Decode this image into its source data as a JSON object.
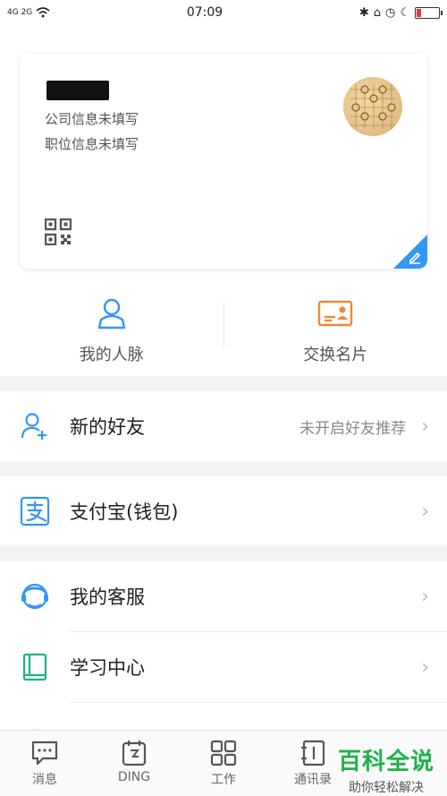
{
  "status_bar": {
    "left_signal": "4G 2G",
    "time": "07:09"
  },
  "card": {
    "company": "公司信息未填写",
    "position": "职位信息未填写"
  },
  "quick": [
    {
      "label": "我的人脉",
      "icon": "contacts-person-icon"
    },
    {
      "label": "交换名片",
      "icon": "business-card-icon"
    }
  ],
  "rows": {
    "new_friends": {
      "title": "新的好友",
      "hint": "未开启好友推荐"
    },
    "alipay": {
      "title": "支付宝(钱包)"
    },
    "service": {
      "title": "我的客服"
    },
    "learning": {
      "title": "学习中心"
    }
  },
  "tabs": [
    {
      "label": "消息",
      "icon": "message-icon"
    },
    {
      "label": "DING",
      "icon": "ding-icon"
    },
    {
      "label": "工作",
      "icon": "work-grid-icon"
    },
    {
      "label": "通讯录",
      "icon": "contacts-book-icon"
    }
  ],
  "watermark": {
    "title": "百科全说",
    "subtitle": "助你轻松解决"
  },
  "colors": {
    "accent": "#3296fa",
    "orange": "#f0883a",
    "green": "#1fb24a",
    "teal": "#19b391"
  }
}
